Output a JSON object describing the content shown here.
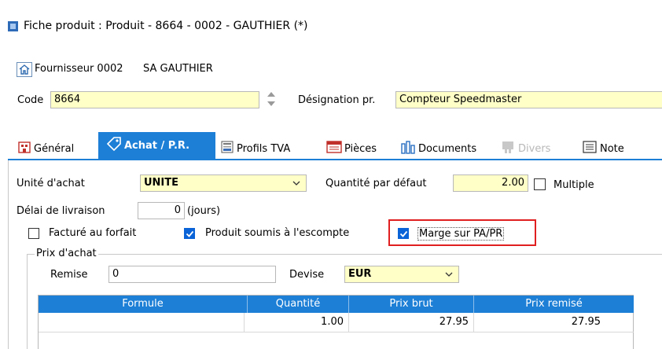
{
  "window": {
    "title": "Fiche produit : Produit - 8664 - 0002 - GAUTHIER (*)"
  },
  "supplier": {
    "prefix": "Fournisseur 0002",
    "name": "SA GAUTHIER"
  },
  "code": {
    "label": "Code",
    "value": "8664"
  },
  "designation": {
    "label": "Désignation pr.",
    "value": "Compteur Speedmaster"
  },
  "tabs": [
    {
      "label": "Général"
    },
    {
      "label": "Achat / P.R."
    },
    {
      "label": "Profils TVA"
    },
    {
      "label": "Pièces"
    },
    {
      "label": "Documents"
    },
    {
      "label": "Divers"
    },
    {
      "label": "Note"
    }
  ],
  "form": {
    "unite_label": "Unité d'achat",
    "unite_value": "UNITE",
    "qte_label": "Quantité par défaut",
    "qte_value": "2.00",
    "multiple_label": "Multiple",
    "delai_label": "Délai de livraison",
    "delai_value": "0",
    "delai_unit": "(jours)",
    "forfait_label": "Facturé au forfait",
    "escompte_label": "Produit soumis à l'escompte",
    "marge_label": "Marge sur PA/PR"
  },
  "prix": {
    "group_label": "Prix d'achat",
    "remise_label": "Remise",
    "remise_value": "0",
    "devise_label": "Devise",
    "devise_value": "EUR"
  },
  "table": {
    "headers": [
      "Formule",
      "Quantité",
      "Prix brut",
      "Prix remisé"
    ],
    "rows": [
      [
        "",
        "1.00",
        "27.95",
        "27.95"
      ]
    ]
  },
  "colors": {
    "accent": "#1e7fd6",
    "highlight_box": "#e02020",
    "field_yellow": "#ffffc8"
  }
}
